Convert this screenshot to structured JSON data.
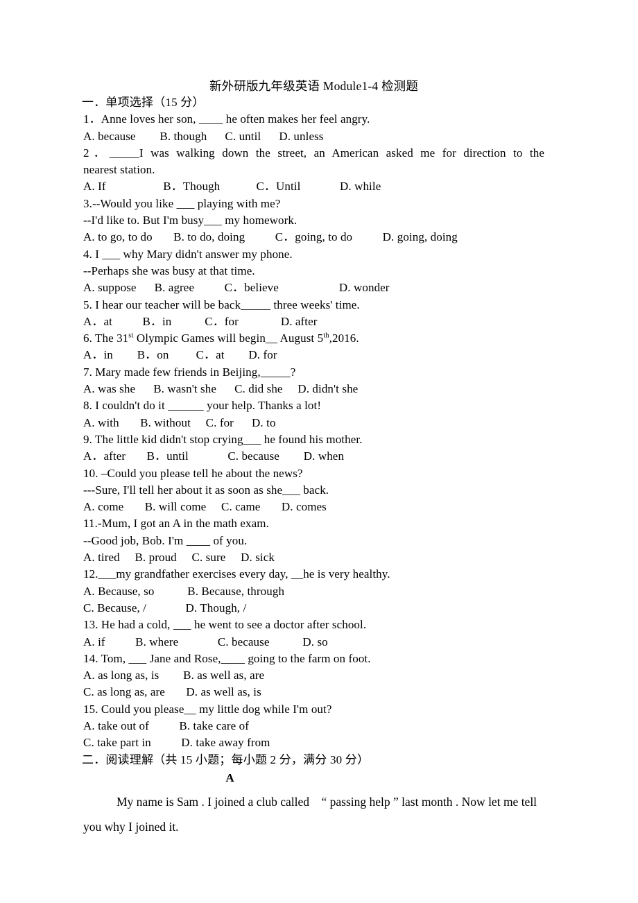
{
  "document": {
    "title": "新外研版九年级英语 Module1-4 检测题",
    "section_one": {
      "heading": "一．单项选择（15 分）",
      "questions": [
        {
          "stem": "1．Anne loves her son, ____ he often makes her feel angry.",
          "options": "A. because        B. though      C. until      D. unless"
        },
        {
          "stem": "2．_____I was walking down the street, an American asked me for direction to the",
          "stem_cont": "nearest station.",
          "options": "A. If                   B．Though            C．Until             D. while"
        },
        {
          "stem": "3.--Would you like ___ playing with me?",
          "stem_cont": "--I'd like to. But I'm busy___ my homework.",
          "options": "A. to go, to do       B. to do, doing          C．going, to do          D. going, doing"
        },
        {
          "stem": "4. I ___ why Mary didn't answer my phone.",
          "stem_cont": "--Perhaps she was busy at that time.",
          "options": "A. suppose      B. agree          C．believe                    D. wonder"
        },
        {
          "stem": "5. I hear our teacher will be back_____ three weeks' time.",
          "options": "A．at          B．in           C．for              D. after"
        },
        {
          "stem_html": "6. The 31<sup>st</sup> Olympic Games will begin__ August 5<sup>th</sup>,2016.",
          "options": "A．in        B．on         C．at        D. for"
        },
        {
          "stem": "7. Mary made few friends in Beijing,_____?",
          "options": "A. was she      B. wasn't she      C. did she     D. didn't she"
        },
        {
          "stem": "8. I couldn't do it ______ your help. Thanks a lot!",
          "options": "A. with       B. without     C. for      D. to"
        },
        {
          "stem": "9. The little kid didn't stop crying___ he found his mother.",
          "options": "A．after       B．until             C. because        D. when"
        },
        {
          "stem": "10. –Could you please tell he about the news?",
          "stem_cont": "---Sure, I'll tell her about it as soon as she___ back.",
          "options": "A. come       B. will come     C. came       D. comes"
        },
        {
          "stem": "11.-Mum, I got an A in the math exam.",
          "stem_cont": "--Good job, Bob. I'm ____ of you.",
          "options": "A. tired     B. proud     C. sure     D. sick"
        },
        {
          "stem": "12.___my grandfather exercises every day, __he is very healthy.",
          "options": "A. Because, so           B. Because, through",
          "options_line2": "C. Because, /             D. Though, /"
        },
        {
          "stem": "13. He had a cold, ___ he went to see a doctor after school.",
          "options": "A. if          B. where             C. because           D. so"
        },
        {
          "stem": "14. Tom, ___ Jane and Rose,____ going to the farm on foot.",
          "options": "A. as long as, is        B. as well as, are",
          "options_line2": "C. as long as, are       D. as well as, is"
        },
        {
          "stem": "15. Could you please__ my little dog while I'm out?",
          "options": "A. take out of          B. take care of",
          "options_line2": "C. take part in          D. take away from"
        }
      ]
    },
    "section_two": {
      "heading": "二．阅读理解（共 15 小题；每小题 2 分，满分 30 分）",
      "passage_label": "A",
      "passage_text": "My name is Sam . I joined a club called    “ passing help ” last month . Now let me tell you why I joined it."
    }
  }
}
